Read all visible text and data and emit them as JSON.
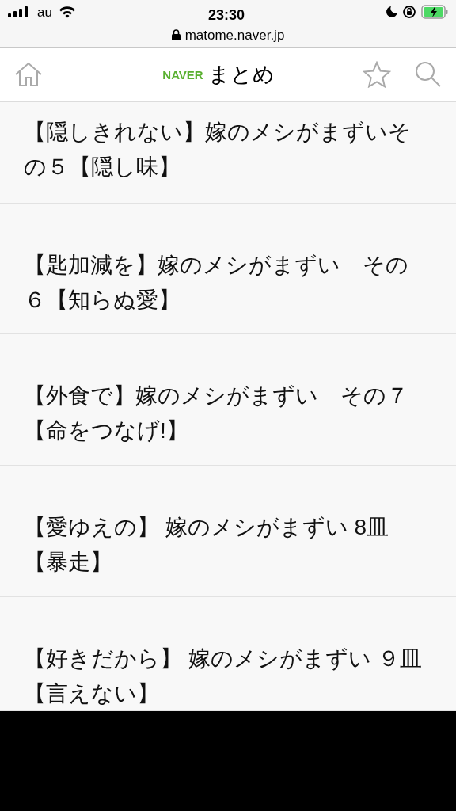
{
  "status_bar": {
    "carrier": "au",
    "time": "23:30"
  },
  "address_bar": {
    "url": "matome.naver.jp"
  },
  "header": {
    "brand": "NAVER",
    "title": "まとめ"
  },
  "articles": [
    {
      "title": "【隠しきれない】嫁のメシがまずいその５【隠し味】"
    },
    {
      "title": "【匙加減を】嫁のメシがまずい　その６【知らぬ愛】"
    },
    {
      "title": "【外食で】嫁のメシがまずい　その７【命をつなげ!】"
    },
    {
      "title": "【愛ゆえの】 嫁のメシがまずい 8皿【暴走】"
    },
    {
      "title": "【好きだから】 嫁のメシがまずい ９皿【言えない】"
    }
  ]
}
